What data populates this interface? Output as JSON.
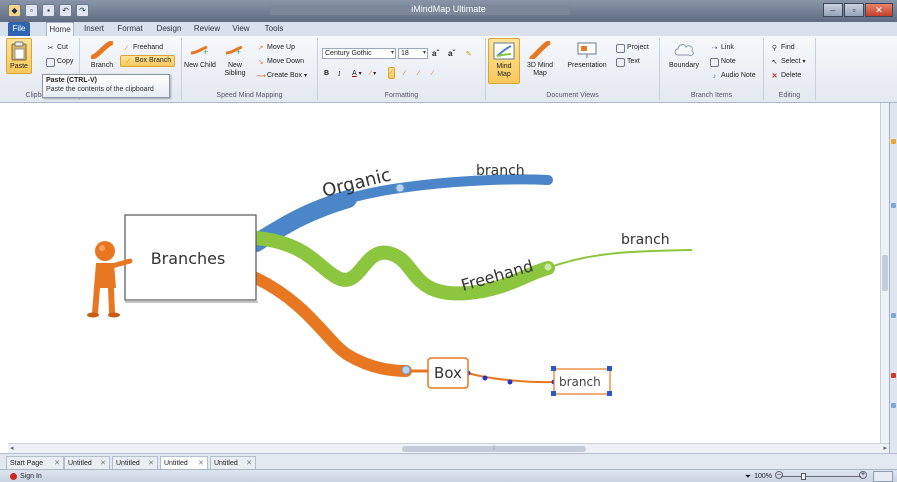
{
  "app": {
    "title": "iMindMap Ultimate"
  },
  "tabs": [
    {
      "label": "File"
    },
    {
      "label": "Home"
    },
    {
      "label": "Insert"
    },
    {
      "label": "Format"
    },
    {
      "label": "Design"
    },
    {
      "label": "Review"
    },
    {
      "label": "View"
    },
    {
      "label": "Tools"
    }
  ],
  "ribbon": {
    "clipboard": {
      "paste": "Paste",
      "cut": "Cut",
      "copy": "Copy",
      "label": "Clipboard"
    },
    "branch": {
      "branch": "Branch",
      "freehand": "Freehand",
      "box_branch": "Box Branch"
    },
    "speed": {
      "new_child": "New Child",
      "new_sibling": "New Sibling",
      "move_up": "Move Up",
      "move_down": "Move Down",
      "create_box": "Create Box",
      "label": "Speed Mind Mapping"
    },
    "formatting": {
      "font": "Century Gothic",
      "size": "18",
      "label": "Formatting"
    },
    "views": {
      "mind_map": "Mind Map",
      "mind_map_3d": "3D Mind Map",
      "presentation": "Presentation",
      "project": "Project",
      "text": "Text",
      "label": "Document Views"
    },
    "branch_items": {
      "boundary": "Boundary",
      "link": "Link",
      "note": "Note",
      "audio_note": "Audio Note",
      "label": "Branch Items"
    },
    "editing": {
      "find": "Find",
      "select": "Select",
      "delete": "Delete",
      "label": "Editing"
    }
  },
  "tooltip": {
    "title": "Paste (CTRL-V)",
    "desc": "Paste the contents of the clipboard"
  },
  "mindmap": {
    "central": "Branches",
    "organic": "Organic",
    "freehand": "Freehand",
    "box": "Box",
    "branch_label": "branch",
    "colors": {
      "blue": "#4a86c8",
      "green": "#8cc63f",
      "orange": "#e87722"
    }
  },
  "doc_tabs": [
    {
      "label": "Start Page"
    },
    {
      "label": "Untitled"
    },
    {
      "label": "Untitled"
    },
    {
      "label": "Untitled"
    },
    {
      "label": "Untitled"
    }
  ],
  "status": {
    "sign_in": "Sign In",
    "zoom": "100%"
  }
}
